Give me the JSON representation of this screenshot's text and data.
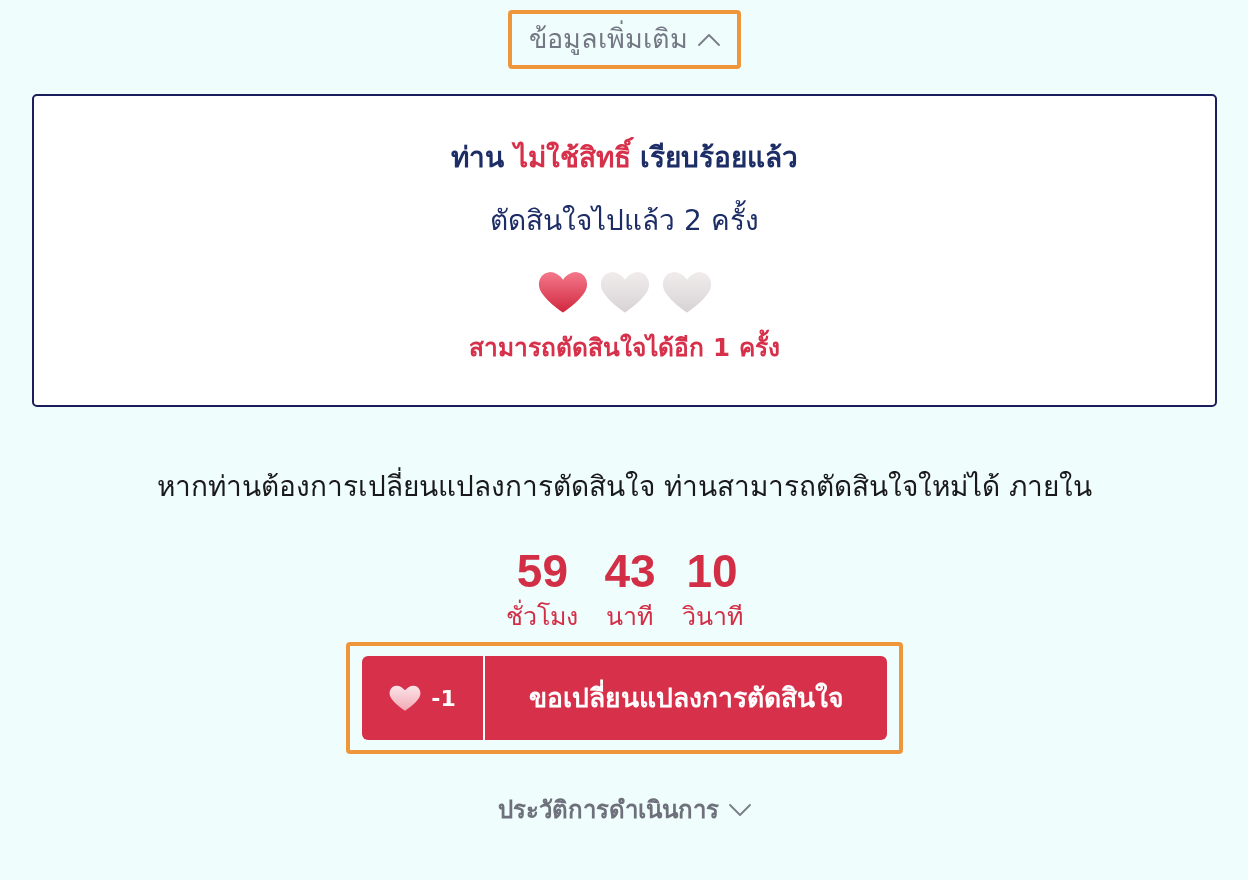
{
  "more_info_toggle": {
    "label": "ข้อมูลเพิ่มเติม",
    "expanded": true,
    "highlighted": true
  },
  "status_card": {
    "title_parts": [
      {
        "text": "ท่าน",
        "emphasis": false
      },
      {
        "text": "ไม่ใช้สิทธิ์",
        "emphasis": true
      },
      {
        "text": "เรียบร้อยแล้ว",
        "emphasis": false
      }
    ],
    "decisions_made": "ตัดสินใจไปแล้ว 2 ครั้ง",
    "hearts": [
      {
        "filled": true
      },
      {
        "filled": false
      },
      {
        "filled": false
      }
    ],
    "remaining": "สามารถตัดสินใจได้อีก 1 ครั้ง"
  },
  "notice": "หากท่านต้องการเปลี่ยนแปลงการตัดสินใจ ท่านสามารถตัดสินใจใหม่ได้ ภายใน",
  "countdown": [
    {
      "value": "59",
      "unit": "ชั่วโมง"
    },
    {
      "value": "43",
      "unit": "นาที"
    },
    {
      "value": "10",
      "unit": "วินาที"
    }
  ],
  "change_button": {
    "cost": "-1",
    "label": "ขอเปลี่ยนแปลงการตัดสินใจ",
    "highlighted": true
  },
  "history_toggle": {
    "label": "ประวัติการดำเนินการ",
    "expanded": false
  }
}
